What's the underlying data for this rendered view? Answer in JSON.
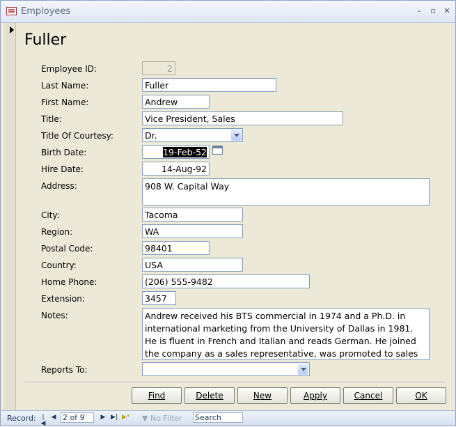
{
  "window": {
    "title": "Employees",
    "controls": [
      "minimize-icon",
      "restore-icon",
      "close-icon"
    ]
  },
  "form": {
    "heading": "Fuller",
    "fields": {
      "employee_id": {
        "label": "Employee ID:",
        "value": "2"
      },
      "last_name": {
        "label": "Last Name:",
        "value": "Fuller"
      },
      "first_name": {
        "label": "First Name:",
        "value": "Andrew"
      },
      "title": {
        "label": "Title:",
        "value": "Vice President, Sales"
      },
      "title_of_courtesy": {
        "label": "Title Of Courtesy:",
        "value": "Dr."
      },
      "birth_date": {
        "label": "Birth Date:",
        "value": "19-Feb-52"
      },
      "hire_date": {
        "label": "Hire Date:",
        "value": "14-Aug-92"
      },
      "address": {
        "label": "Address:",
        "value": "908 W. Capital Way"
      },
      "city": {
        "label": "City:",
        "value": "Tacoma"
      },
      "region": {
        "label": "Region:",
        "value": "WA"
      },
      "postal_code": {
        "label": "Postal Code:",
        "value": "98401"
      },
      "country": {
        "label": "Country:",
        "value": "USA"
      },
      "home_phone": {
        "label": "Home Phone:",
        "value": "(206) 555-9482"
      },
      "extension": {
        "label": "Extension:",
        "value": "3457"
      },
      "notes": {
        "label": "Notes:",
        "value": "Andrew received his BTS commercial in 1974 and a Ph.D. in international marketing from the University of Dallas in 1981.  He is fluent in French and Italian and reads German.  He joined the company as a sales representative, was promoted to sales"
      },
      "reports_to": {
        "label": "Reports To:",
        "value": ""
      }
    },
    "buttons": {
      "find": "Find",
      "delete": "Delete",
      "new": "New",
      "apply": "Apply",
      "cancel": "Cancel",
      "ok": "OK"
    }
  },
  "statusbar": {
    "record_label": "Record:",
    "record_value": "2 of 9",
    "filter_label": "No Filter",
    "search_placeholder": "Search"
  }
}
